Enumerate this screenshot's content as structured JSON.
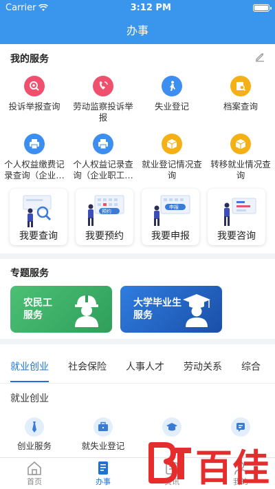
{
  "status": {
    "carrier": "Carrier",
    "time": "3:12 PM"
  },
  "nav": {
    "title": "办事"
  },
  "my_services": {
    "title": "我的服务",
    "items": [
      {
        "label": "投诉举报查询",
        "icon": "complaint-search-icon",
        "color": "#f0506e"
      },
      {
        "label": "劳动监察投诉举报",
        "icon": "labor-inspection-icon",
        "color": "#f0506e"
      },
      {
        "label": "失业登记",
        "icon": "unemployment-register-icon",
        "color": "#3c8ef0"
      },
      {
        "label": "档案查询",
        "icon": "archive-search-icon",
        "color": "#f5b016"
      },
      {
        "label": "个人权益缴费记录查询（企业…",
        "icon": "printer-icon",
        "color": "#3c8ef0"
      },
      {
        "label": "个人权益记录查询（企业职工…",
        "icon": "printer-icon",
        "color": "#3c8ef0"
      },
      {
        "label": "就业登记情况查询",
        "icon": "box-icon",
        "color": "#f5b016"
      },
      {
        "label": "转移就业情况查询",
        "icon": "box-icon",
        "color": "#f5b016"
      }
    ],
    "cards": [
      {
        "label": "我要查询",
        "badge": ""
      },
      {
        "label": "我要预约",
        "badge": "预约"
      },
      {
        "label": "我要申报",
        "badge": "申报"
      },
      {
        "label": "我要咨询",
        "badge": ""
      }
    ]
  },
  "special": {
    "title": "专题服务",
    "cards": [
      {
        "line1": "农民工",
        "line2": "服务",
        "color": "#3aa863"
      },
      {
        "line1": "大学毕业生",
        "line2": "服务",
        "color": "#1f5fb8"
      }
    ]
  },
  "categories": {
    "tabs": [
      "就业创业",
      "社会保险",
      "人事人才",
      "劳动关系",
      "综合"
    ],
    "active_tab": 0,
    "section_title": "就业创业",
    "items": [
      {
        "label": "创业服务",
        "icon": "tie-icon"
      },
      {
        "label": "就失业登记",
        "icon": "briefcase-icon"
      },
      {
        "label": "",
        "icon": "graduation-cap-icon"
      },
      {
        "label": "",
        "icon": "chat-icon"
      }
    ]
  },
  "tabbar": {
    "items": [
      {
        "label": "首页",
        "icon": "home-icon"
      },
      {
        "label": "办事",
        "icon": "document-icon"
      },
      {
        "label": "资讯",
        "icon": "news-icon"
      },
      {
        "label": "我的",
        "icon": "user-icon"
      }
    ],
    "active": 1
  },
  "watermark": {
    "text": "百佳",
    "color": "#e52d2d"
  }
}
